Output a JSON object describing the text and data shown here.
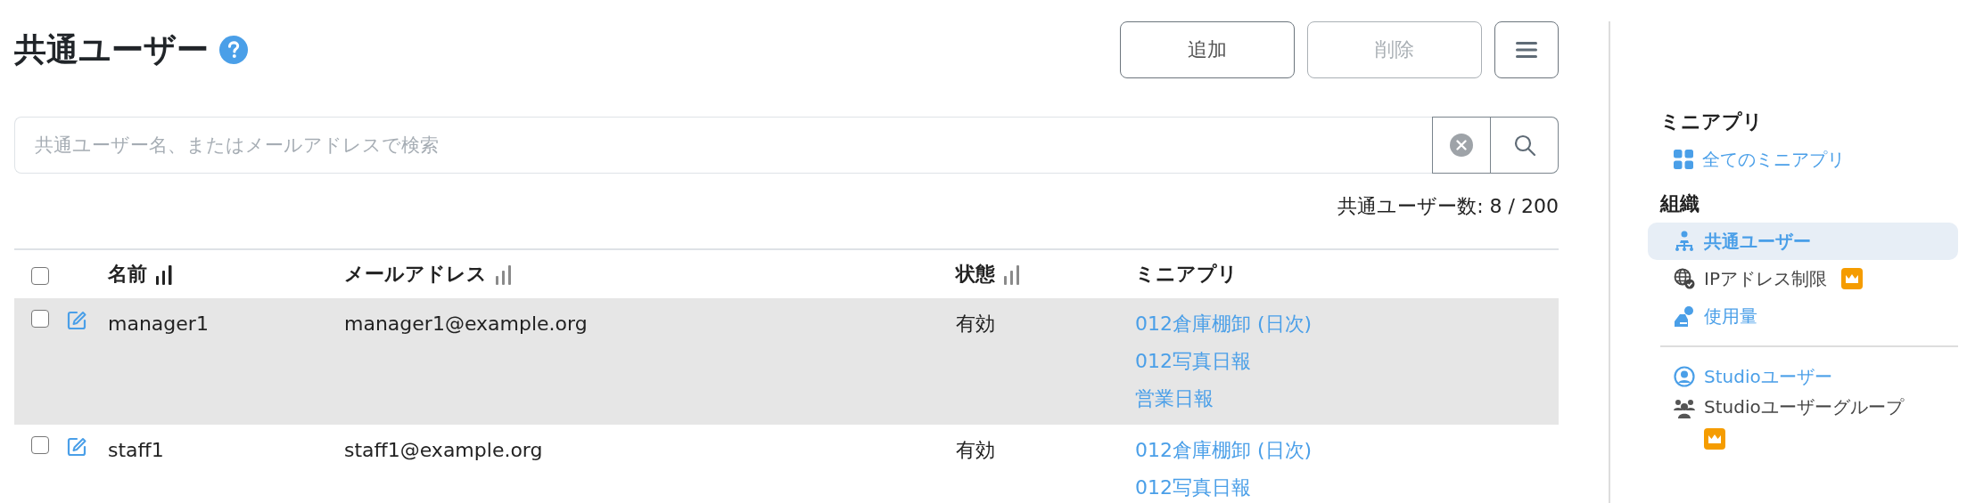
{
  "page": {
    "title": "共通ユーザー"
  },
  "toolbar": {
    "buttons": [
      {
        "label": "追加",
        "disabled": false
      },
      {
        "label": "削除",
        "disabled": true
      }
    ]
  },
  "search": {
    "placeholder": "共通ユーザー名、またはメールアドレスで検索"
  },
  "count": "共通ユーザー数: 8 / 200",
  "table": {
    "header_checked": false,
    "columns": [
      {
        "label": "名前",
        "kind": "sortable",
        "sort_active": true
      },
      {
        "label": "メールアドレス",
        "kind": "sortable",
        "sort_active": false
      },
      {
        "label": "状態",
        "kind": "sortable",
        "sort_active": false
      },
      {
        "label": "ミニアプリ",
        "kind": "plain"
      }
    ],
    "rows": [
      {
        "checked": false,
        "selected": true,
        "name": "manager1",
        "email": "manager1@example.org",
        "status": "有効",
        "apps": [
          "012倉庫棚卸 (日次)",
          "012写真日報",
          "営業日報"
        ]
      },
      {
        "checked": false,
        "selected": false,
        "name": "staff1",
        "email": "staff1@example.org",
        "status": "有効",
        "apps": [
          "012倉庫棚卸 (日次)",
          "012写真日報"
        ]
      }
    ]
  },
  "sidebar": {
    "sections": [
      {
        "title": "ミニアプリ",
        "groups": [
          [
            {
              "label": "全てのミニアプリ",
              "selected": false,
              "premium": false
            }
          ]
        ]
      },
      {
        "title": "組織",
        "groups": [
          [
            {
              "label": "共通ユーザー",
              "selected": true,
              "premium": false
            },
            {
              "label": "IPアドレス制限",
              "selected": false,
              "premium": true
            },
            {
              "label": "使用量",
              "selected": false,
              "premium": false
            }
          ],
          [
            {
              "label": "Studioユーザー",
              "selected": false,
              "premium": false
            },
            {
              "label": "Studioユーザーグループ",
              "selected": false,
              "premium": true
            }
          ]
        ]
      }
    ]
  }
}
